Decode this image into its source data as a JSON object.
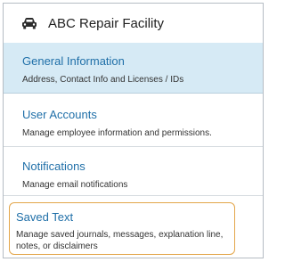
{
  "header": {
    "icon": "car-icon",
    "title": "ABC Repair Facility"
  },
  "sections": {
    "general": {
      "title": "General Information",
      "description": "Address, Contact Info and Licenses / IDs"
    },
    "accounts": {
      "title": "User Accounts",
      "description": "Manage employee information and permissions."
    },
    "notifications": {
      "title": "Notifications",
      "description": "Manage email notifications"
    },
    "saved_text": {
      "title": "Saved Text",
      "description": "Manage saved journals, messages, explanation line, notes, or disclaimers"
    }
  },
  "colors": {
    "link": "#1f6fa8",
    "selected_bg": "#d6eaf5",
    "highlight_border": "#e3a64a"
  }
}
